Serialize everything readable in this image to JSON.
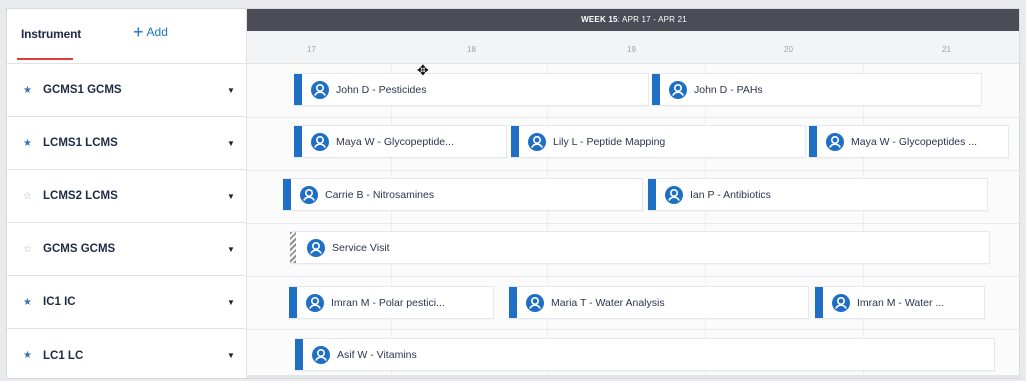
{
  "left_header": {
    "instrument_tab": "Instrument",
    "add_label": "Add"
  },
  "week_bar": {
    "week": "WEEK 15",
    "range": ": APR 17 - APR 21"
  },
  "days": [
    "17",
    "18",
    "19",
    "20",
    "21"
  ],
  "instruments": [
    {
      "name": "GCMS1 GCMS",
      "starred": true
    },
    {
      "name": "LCMS1 LCMS",
      "starred": true
    },
    {
      "name": "LCMS2 LCMS",
      "starred": false
    },
    {
      "name": "GCMS GCMS",
      "starred": false
    },
    {
      "name": "IC1 IC",
      "starred": true
    },
    {
      "name": "LC1 LC",
      "starred": true
    }
  ],
  "bookings": [
    {
      "label": "John D - Pesticides",
      "type": "user"
    },
    {
      "label": "John D - PAHs",
      "type": "user"
    },
    {
      "label": "Maya W - Glycopeptide...",
      "type": "user"
    },
    {
      "label": "Lily L - Peptide Mapping",
      "type": "user"
    },
    {
      "label": "Maya W - Glycopeptides ...",
      "type": "user"
    },
    {
      "label": "Carrie B - Nitrosamines",
      "type": "user"
    },
    {
      "label": "Ian P - Antibiotics",
      "type": "user"
    },
    {
      "label": "Service Visit",
      "type": "service"
    },
    {
      "label": "Imran M - Polar pestici...",
      "type": "user"
    },
    {
      "label": "Maria T - Water Analysis",
      "type": "user"
    },
    {
      "label": "Imran M - Water ...",
      "type": "user"
    },
    {
      "label": "Asif W - Vitamins",
      "type": "user"
    }
  ],
  "icons": {
    "star": "star-icon",
    "caret": "caret-down-icon",
    "user": "user-icon",
    "add": "plus-icon",
    "cursor": "move-cursor-icon"
  },
  "colors": {
    "accent_blue": "#1f6fc4",
    "tab_underline": "#e03a3a",
    "week_bar": "#4a4d55"
  }
}
